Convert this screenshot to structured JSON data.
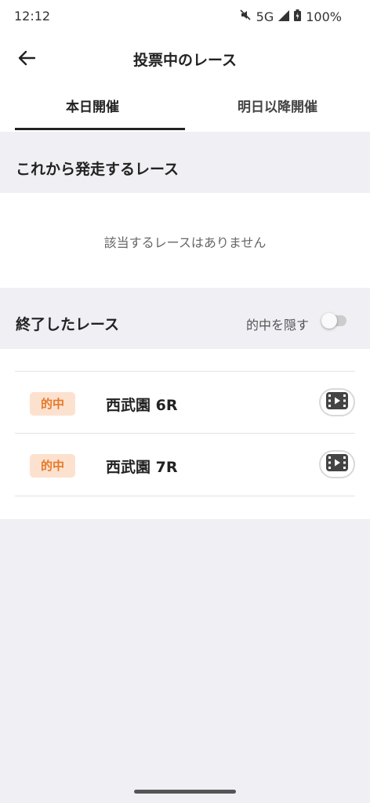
{
  "status_bar": {
    "time": "12:12",
    "network": "5G",
    "battery": "100%"
  },
  "app_bar": {
    "title": "投票中のレース",
    "back_icon": "arrow-left-icon"
  },
  "tabs": [
    {
      "label": "本日開催",
      "active": true
    },
    {
      "label": "明日以降開催",
      "active": false
    }
  ],
  "upcoming": {
    "heading": "これから発走するレース",
    "empty_message": "該当するレースはありません"
  },
  "finished": {
    "heading": "終了したレース",
    "hide_hits_label": "的中を隠す",
    "hide_hits_on": false,
    "races": [
      {
        "badge": "的中",
        "name": "西武園 6R",
        "video_icon": "video-icon"
      },
      {
        "badge": "的中",
        "name": "西武園 7R",
        "video_icon": "video-icon"
      }
    ]
  },
  "colors": {
    "badge_bg": "#fde1cf",
    "badge_text": "#e57a2a",
    "background": "#efeff4"
  }
}
